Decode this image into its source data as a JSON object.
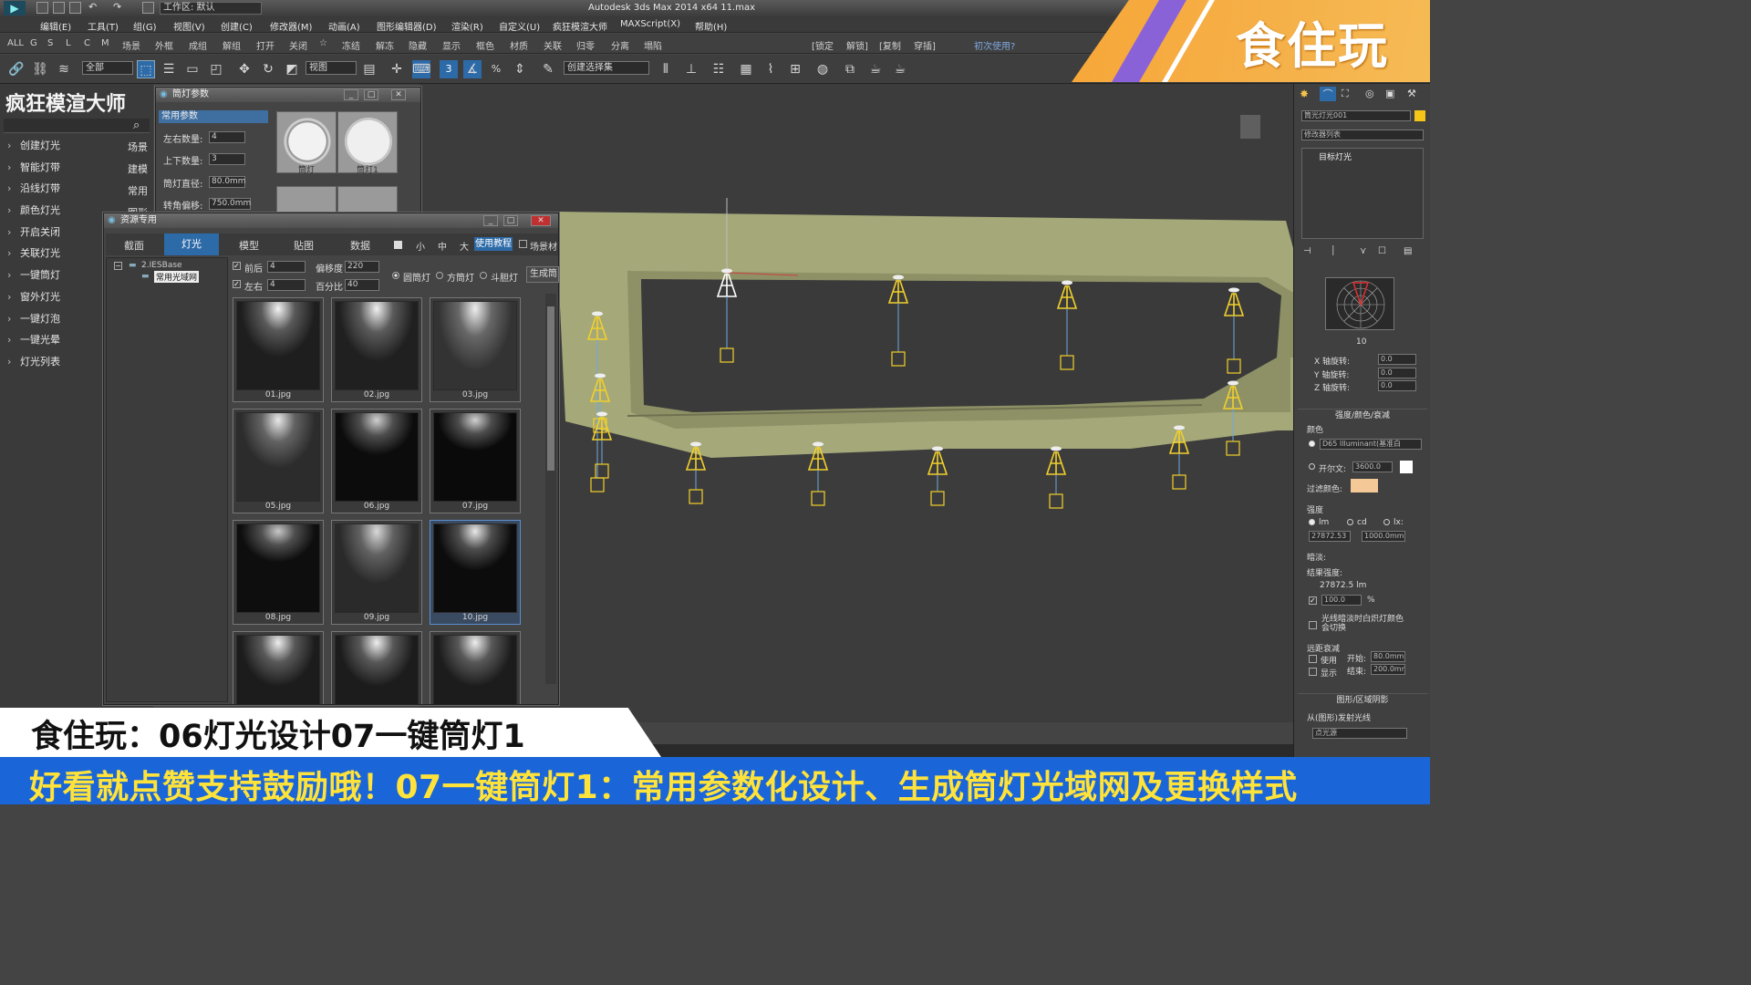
{
  "titlebar": {
    "workspace": "工作区: 默认",
    "app_title": "Autodesk 3ds Max  2014 x64     11.max"
  },
  "menu": [
    "编辑(E)",
    "工具(T)",
    "组(G)",
    "视图(V)",
    "创建(C)",
    "修改器(M)",
    "动画(A)",
    "图形编辑器(D)",
    "渲染(R)",
    "自定义(U)",
    "疯狂模渲大师",
    "MAXScript(X)",
    "帮助(H)"
  ],
  "toolbar1": {
    "left_letters": [
      "ALL",
      "G",
      "S",
      "L",
      "C",
      "M"
    ],
    "items": [
      "场景",
      "外框",
      "成组",
      "解组",
      "打开",
      "关闭",
      "☆",
      "冻结",
      "解冻",
      "隐藏",
      "显示",
      "框色",
      "材质",
      "关联",
      "归零",
      "分离",
      "塌陷"
    ],
    "right_items": [
      "[锁定",
      "解锁]",
      "[复制",
      "穿插]"
    ],
    "first_use": "初次使用?",
    "swatch_colors": [
      "#e05050",
      "#d8a8e8",
      "#68d8d8",
      "#28c028",
      "#38c8e0",
      "#d8e8a0"
    ]
  },
  "toolbar2": {
    "select_filter": "全部",
    "view_combo": "视图",
    "named_selection": "创建选择集"
  },
  "brand": {
    "text": "食住玩"
  },
  "sidebar": {
    "title": "疯狂模渲大师",
    "items": [
      "创建灯光",
      "智能灯带",
      "沿线灯带",
      "颜色灯光",
      "开启关闭",
      "关联灯光",
      "一键筒灯",
      "窗外灯光",
      "一键灯泡",
      "一键光晕",
      "灯光列表"
    ],
    "tabs": [
      "场景",
      "建模",
      "常用",
      "图形"
    ]
  },
  "downlight_panel": {
    "title": "筒灯参数",
    "section": "常用参数",
    "fields": [
      {
        "label": "左右数量:",
        "value": "4"
      },
      {
        "label": "上下数量:",
        "value": "3"
      },
      {
        "label": "筒灯直径:",
        "value": "80.0mm"
      },
      {
        "label": "转角偏移:",
        "value": "750.0mm"
      }
    ],
    "thumbs": [
      "筒灯",
      "筒灯1"
    ]
  },
  "resource_panel": {
    "title": "资源专用",
    "tabs": [
      "截面",
      "灯光",
      "模型",
      "贴图",
      "数据"
    ],
    "active_tab": "灯光",
    "size_options": [
      "小",
      "中",
      "大"
    ],
    "tutorial_btn": "使用教程",
    "scene_check": "场景材",
    "tree_root": "2.IESBase",
    "tree_child": "常用光域网",
    "row1": {
      "label": "前后",
      "value": "4",
      "offset_label": "偏移度",
      "offset_value": "220"
    },
    "row2": {
      "label": "左右",
      "value": "4",
      "pct_label": "百分比",
      "pct_value": "40"
    },
    "lamp_types": [
      "圆筒灯",
      "方筒灯",
      "斗胆灯"
    ],
    "generate_btn": "生成筒",
    "thumbs": [
      "01.jpg",
      "02.jpg",
      "03.jpg",
      "05.jpg",
      "06.jpg",
      "07.jpg",
      "08.jpg",
      "09.jpg",
      "10.jpg",
      "",
      "",
      ""
    ]
  },
  "cmd_panel": {
    "object_name": "筒光灯光001",
    "modifier_list": "修改器列表",
    "stack_item": "目标灯光",
    "web_value": "10",
    "rotations": [
      {
        "label": "X 轴旋转:",
        "value": "0.0"
      },
      {
        "label": "Y 轴旋转:",
        "value": "0.0"
      },
      {
        "label": "Z 轴旋转:",
        "value": "0.0"
      }
    ],
    "intensity_section": "强度/颜色/衰减",
    "color_label": "颜色",
    "illuminant": "D65 Illuminant(基准白",
    "kelvin_label": "开尔文:",
    "kelvin_value": "3600.0",
    "filter_label": "过滤颜色:",
    "filter_color": "#f5c898",
    "strength_label": "强度",
    "units": [
      "lm",
      "cd",
      "lx:"
    ],
    "intensity_value": "27872.53",
    "distance_value": "1000.0mm",
    "dimming_label": "暗淡:",
    "result_label": "结果强度:",
    "result_value": "27872.5 lm",
    "dim_pct": "100.0",
    "pct_sign": "%",
    "incandescent": "光线暗淡时白炽灯颜色会切换",
    "far_atten": "远距衰减",
    "use_label": "使用",
    "start_label": "开始:",
    "start_value": "80.0mm",
    "show_label": "显示",
    "end_label": "结束:",
    "end_value": "200.0mm",
    "shape_section": "图形/区域阴影",
    "emit_label": "从(图形)发射光线",
    "emit_value": "点光源"
  },
  "captions": {
    "line1": "食住玩：06灯光设计07一键筒灯1",
    "line2": "好看就点赞支持鼓励哦！07一键筒灯1：常用参数化设计、生成筒灯光域网及更换样式"
  }
}
